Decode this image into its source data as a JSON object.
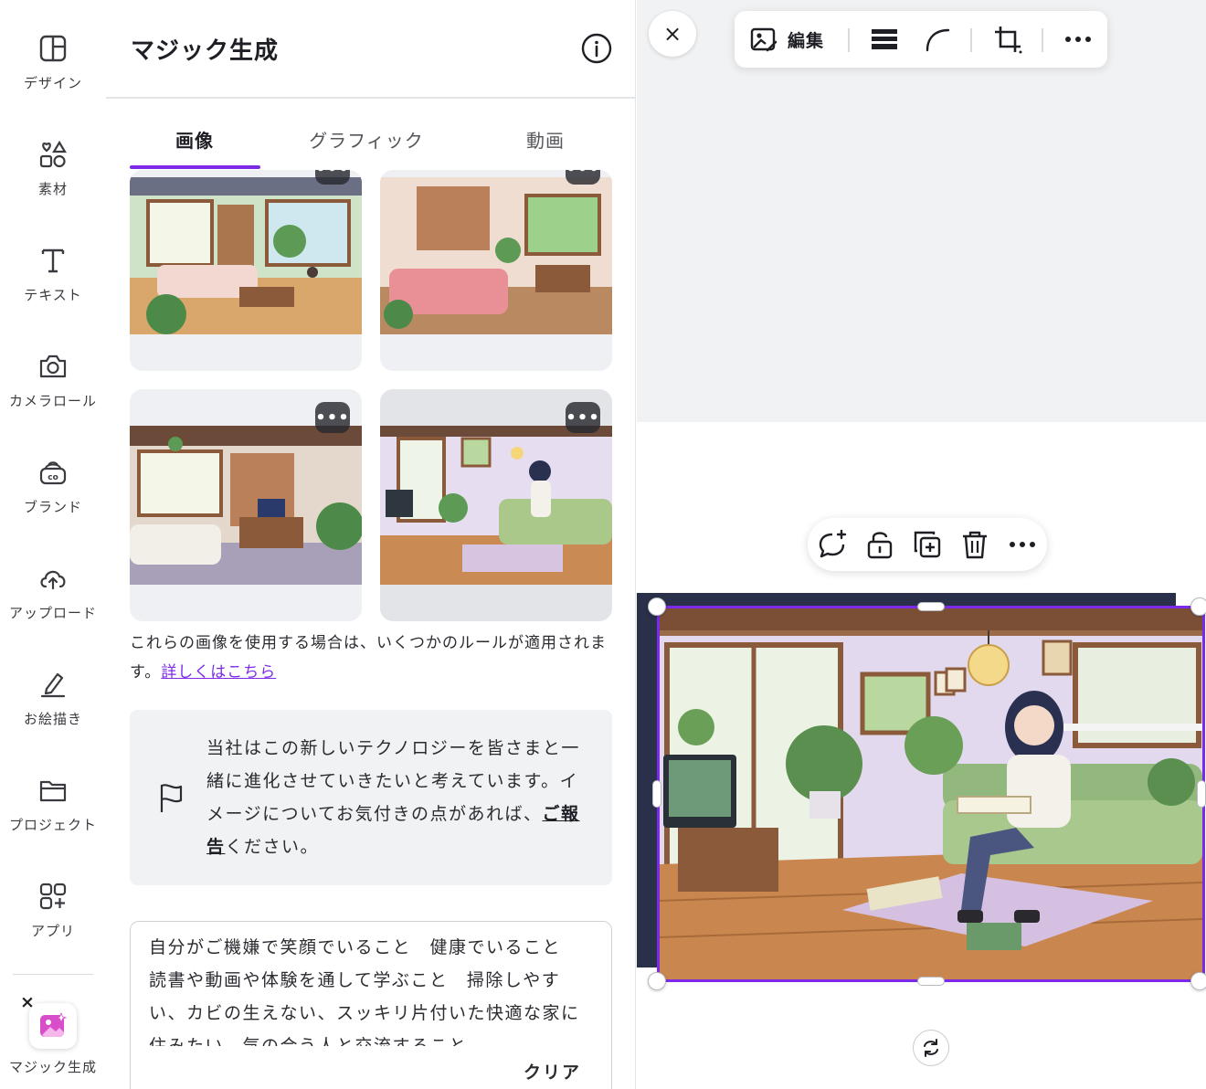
{
  "rail": {
    "items": [
      {
        "label": "デザイン",
        "icon": "design-layout-icon"
      },
      {
        "label": "素材",
        "icon": "elements-shapes-icon"
      },
      {
        "label": "テキスト",
        "icon": "text-t-icon"
      },
      {
        "label": "カメラロール",
        "icon": "camera-icon"
      },
      {
        "label": "ブランド",
        "icon": "brand-icon"
      },
      {
        "label": "アップロード",
        "icon": "cloud-upload-icon"
      },
      {
        "label": "お絵描き",
        "icon": "draw-pen-icon"
      },
      {
        "label": "プロジェクト",
        "icon": "folder-icon"
      },
      {
        "label": "アプリ",
        "icon": "apps-grid-icon"
      }
    ],
    "magic": {
      "label": "マジック生成",
      "close": "×",
      "icon": "magic-image-icon",
      "accent": "#d84ec9"
    }
  },
  "panel": {
    "title": "マジック生成",
    "info_icon": "info-icon",
    "tabs": [
      {
        "label": "画像",
        "active": true
      },
      {
        "label": "グラフィック",
        "active": false
      },
      {
        "label": "動画",
        "active": false
      }
    ],
    "accent": "#7d2ae8",
    "more_label": "•••",
    "rules_text": "これらの画像を使用する場合は、いくつかのルールが適用されます。",
    "rules_link": "詳しくはこちら",
    "notice": {
      "text_before": "当社はこの新しいテクノロジーを皆さまと一緒に進化させていきたいと考えています。イメージについてお気付きの点があれば、",
      "link": "ご報告",
      "text_after": "ください。",
      "icon": "flag-icon"
    },
    "prompt": {
      "text": "自分がご機嫌で笑顔でいること　健康でいること　読書や動画や体験を通して学ぶこと　掃除しやすい、カビの生えない、スッキリ片付いた快適な家に住みたい　気の合う人と交流すること",
      "clear_label": "クリア"
    }
  },
  "canvas": {
    "close": "×",
    "toolbar": {
      "edit_label": "編集",
      "icons": [
        "image-edit-icon",
        "border-weight-icon",
        "corner-rounding-icon",
        "crop-icon",
        "more-icon"
      ]
    },
    "float_bar_icons": [
      "add-comment-icon",
      "lock-icon",
      "duplicate-icon",
      "delete-icon",
      "more-icon"
    ],
    "rotate_icon": "rotate-icon",
    "selection_color": "#7d2ae8"
  }
}
